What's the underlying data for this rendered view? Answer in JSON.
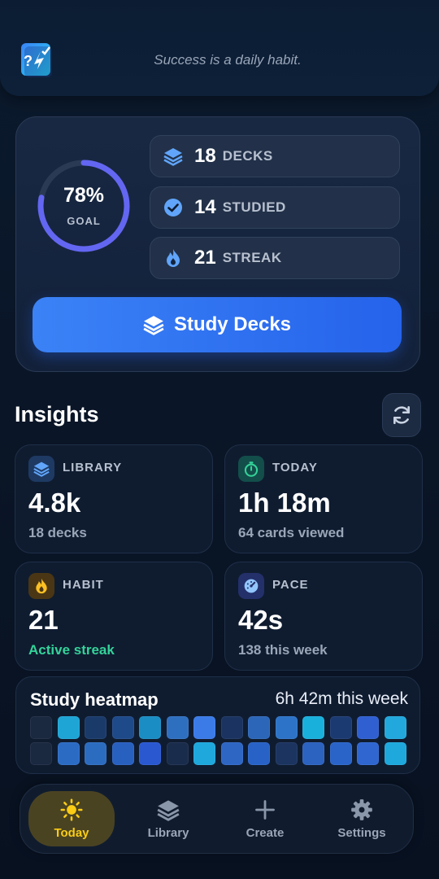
{
  "header": {
    "tagline": "Success is a daily habit."
  },
  "hero": {
    "goal_percent_text": "78%",
    "goal_percent_value": 78,
    "goal_label": "GOAL",
    "stats": [
      {
        "icon": "layers-icon",
        "value": "18",
        "label": "DECKS"
      },
      {
        "icon": "check-circle-icon",
        "value": "14",
        "label": "STUDIED"
      },
      {
        "icon": "flame-icon",
        "value": "21",
        "label": "STREAK"
      }
    ],
    "study_button_label": "Study Decks"
  },
  "insights": {
    "title": "Insights",
    "cards": [
      {
        "icon": "layers-icon",
        "caption": "LIBRARY",
        "value": "4.8k",
        "sub": "18 decks"
      },
      {
        "icon": "stopwatch-icon",
        "caption": "TODAY",
        "value": "1h 18m",
        "sub": "64 cards viewed"
      },
      {
        "icon": "flame-icon",
        "caption": "HABIT",
        "value": "21",
        "sub": "Active streak"
      },
      {
        "icon": "gauge-icon",
        "caption": "PACE",
        "value": "42s",
        "sub": "138 this week"
      }
    ]
  },
  "heatmap": {
    "title": "Study heatmap",
    "total": "6h 42m this week",
    "rows": [
      [
        "#1a2840",
        "#1ea5d6",
        "#1a3a6a",
        "#1e4a8a",
        "#1a8dc4",
        "#2f6fc0",
        "#3b7be8",
        "#1b3360",
        "#2c66b8",
        "#2d74c8",
        "#1ab0dc",
        "#1c3a72",
        "#2f5fd0",
        "#22a8dc"
      ],
      [
        "#1a2840",
        "#2b6bc4",
        "#2c6cc0",
        "#2860c0",
        "#2958d0",
        "#1a2c4c",
        "#1ea8dc",
        "#2e66c4",
        "#2862c6",
        "#1b3460",
        "#2c62c0",
        "#2a64c8",
        "#2f66d0",
        "#1ea8dc"
      ]
    ]
  },
  "nav": {
    "items": [
      {
        "label": "Today",
        "icon": "sun-icon",
        "active": true
      },
      {
        "label": "Library",
        "icon": "layers-icon",
        "active": false
      },
      {
        "label": "Create",
        "icon": "plus-icon",
        "active": false
      },
      {
        "label": "Settings",
        "icon": "gear-icon",
        "active": false
      }
    ]
  },
  "colors": {
    "accent": "#3b82f6",
    "ring_fill": "#6366f1",
    "active_green": "#34d399",
    "nav_active": "#facc15"
  }
}
